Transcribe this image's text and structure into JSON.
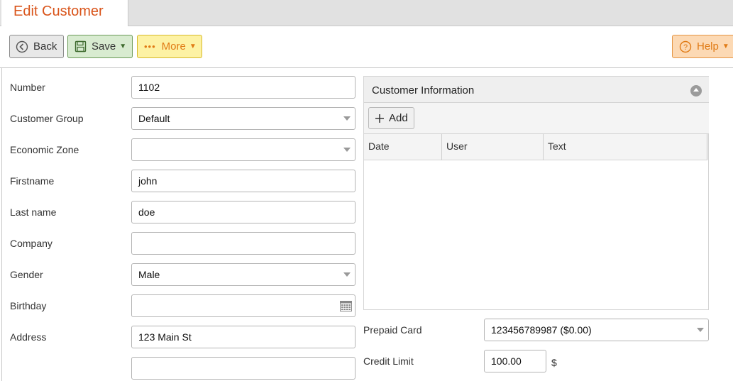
{
  "tab": {
    "title": "Edit Customer"
  },
  "toolbar": {
    "back_label": "Back",
    "save_label": "Save",
    "more_label": "More",
    "help_label": "Help"
  },
  "form": {
    "number": {
      "label": "Number",
      "value": "1102"
    },
    "customer_group": {
      "label": "Customer Group",
      "value": "Default"
    },
    "economic_zone": {
      "label": "Economic Zone",
      "value": ""
    },
    "firstname": {
      "label": "Firstname",
      "value": "john"
    },
    "last_name": {
      "label": "Last name",
      "value": "doe"
    },
    "company": {
      "label": "Company",
      "value": ""
    },
    "gender": {
      "label": "Gender",
      "value": "Male"
    },
    "birthday": {
      "label": "Birthday",
      "value": ""
    },
    "address": {
      "label": "Address",
      "value": "123 Main St",
      "line2": ""
    },
    "prepaid_card": {
      "label": "Prepaid Card",
      "value": "123456789987 ($0.00)"
    },
    "credit_limit": {
      "label": "Credit Limit",
      "value": "100.00",
      "unit": "$"
    }
  },
  "info_panel": {
    "title": "Customer Information",
    "add_label": "Add",
    "columns": [
      "Date",
      "User",
      "Text"
    ],
    "rows": []
  },
  "colors": {
    "accent": "#d9541a",
    "save": "#d8ebd0",
    "more": "#fdf2a4",
    "help": "#fcd9b4"
  }
}
